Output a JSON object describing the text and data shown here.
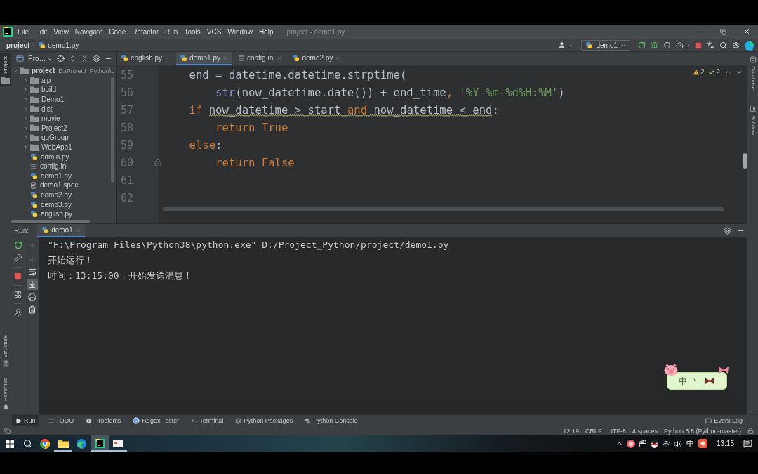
{
  "title_bar": {
    "menu": [
      "File",
      "Edit",
      "View",
      "Navigate",
      "Code",
      "Refactor",
      "Run",
      "Tools",
      "VCS",
      "Window",
      "Help"
    ],
    "title": "project - demo1.py"
  },
  "nav_bar": {
    "breadcrumbs": [
      {
        "label": "project",
        "kind": "folder"
      },
      {
        "label": "demo1.py",
        "kind": "python"
      }
    ],
    "run_config": "demo1"
  },
  "left_strip": [
    {
      "label": "Project",
      "kind": "project",
      "selected": true
    },
    {
      "label": "Structure",
      "kind": "structure",
      "selected": false
    },
    {
      "label": "Favorites",
      "kind": "favorites",
      "selected": false
    }
  ],
  "project_panel": {
    "title": "Pro…",
    "tree": [
      {
        "name": "project",
        "path": "D:\\Project_Python\\p",
        "kind": "folder",
        "expanded": true,
        "children": [
          {
            "name": "aip",
            "kind": "folder",
            "expanded": false
          },
          {
            "name": "build",
            "kind": "folder",
            "expanded": false
          },
          {
            "name": "Demo1",
            "kind": "folder",
            "expanded": false
          },
          {
            "name": "dist",
            "kind": "folder",
            "expanded": false
          },
          {
            "name": "movie",
            "kind": "folder",
            "expanded": false
          },
          {
            "name": "Project2",
            "kind": "folder",
            "expanded": false
          },
          {
            "name": "qqGroup",
            "kind": "folder",
            "expanded": false
          },
          {
            "name": "WebApp1",
            "kind": "folder",
            "expanded": false
          },
          {
            "name": "admin.py",
            "kind": "python"
          },
          {
            "name": "config.ini",
            "kind": "config"
          },
          {
            "name": "demo1.py",
            "kind": "python"
          },
          {
            "name": "demo1.spec",
            "kind": "spec"
          },
          {
            "name": "demo2.py",
            "kind": "python"
          },
          {
            "name": "demo3.py",
            "kind": "python"
          },
          {
            "name": "english.py",
            "kind": "python"
          }
        ]
      }
    ]
  },
  "editor": {
    "tabs": [
      {
        "label": "english.py",
        "kind": "python",
        "selected": false
      },
      {
        "label": "demo1.py",
        "kind": "python",
        "selected": true
      },
      {
        "label": "config.ini",
        "kind": "config",
        "selected": false
      },
      {
        "label": "demo2.py",
        "kind": "python",
        "selected": false
      }
    ],
    "inspections": [
      {
        "kind": "warning",
        "count": "2"
      },
      {
        "kind": "weak",
        "count": "2"
      }
    ],
    "lines": [
      {
        "number": "55",
        "fold": false,
        "tokens": [
          {
            "text": "    end = datetime.datetime.strptime(",
            "kind": "plain",
            "squiggle": false
          }
        ]
      },
      {
        "number": "56",
        "fold": false,
        "tokens": [
          {
            "text": "        str",
            "kind": "builtin",
            "squiggle": false
          },
          {
            "text": "(now_datetime.date()) + end_time",
            "kind": "plain",
            "squiggle": false
          },
          {
            "text": ", ",
            "kind": "punctuation",
            "squiggle": false
          },
          {
            "text": "'%Y-%m-%d%H:%M'",
            "kind": "string",
            "squiggle": false
          },
          {
            "text": ")",
            "kind": "plain",
            "squiggle": false
          }
        ]
      },
      {
        "number": "57",
        "fold": false,
        "tokens": [
          {
            "text": "    if ",
            "kind": "keyword",
            "squiggle": false
          },
          {
            "text": "now_datetime > start ",
            "kind": "plain",
            "squiggle": true
          },
          {
            "text": "and",
            "kind": "keyword",
            "squiggle": true
          },
          {
            "text": " now_datetime < end",
            "kind": "plain",
            "squiggle": true
          },
          {
            "text": ":",
            "kind": "plain",
            "squiggle": false
          }
        ]
      },
      {
        "number": "58",
        "fold": false,
        "tokens": [
          {
            "text": "        return True",
            "kind": "keyword",
            "squiggle": false
          }
        ]
      },
      {
        "number": "59",
        "fold": false,
        "tokens": [
          {
            "text": "    else",
            "kind": "keyword",
            "squiggle": false
          },
          {
            "text": ":",
            "kind": "plain",
            "squiggle": false
          }
        ]
      },
      {
        "number": "60",
        "fold": true,
        "tokens": [
          {
            "text": "        return False",
            "kind": "keyword",
            "squiggle": false
          }
        ]
      },
      {
        "number": "61",
        "fold": false
      },
      {
        "number": "62",
        "fold": false
      }
    ]
  },
  "right_strip": [
    {
      "label": "Database",
      "kind": "database"
    },
    {
      "label": "SciView",
      "kind": "sciview"
    }
  ],
  "run_window": {
    "label": "Run:",
    "tabs": [
      {
        "label": "demo1",
        "selected": true
      }
    ],
    "console_tools": [
      {
        "kind": "up",
        "disabled": true,
        "on": false
      },
      {
        "kind": "down",
        "disabled": true,
        "on": false
      },
      {
        "kind": "wrap",
        "disabled": false,
        "on": false
      },
      {
        "kind": "scroll",
        "disabled": false,
        "on": true
      },
      {
        "kind": "print",
        "disabled": false,
        "on": false
      },
      {
        "kind": "trash",
        "disabled": false,
        "on": false
      }
    ],
    "console": [
      "\"F:\\Program Files\\Python38\\python.exe\" D:/Project_Python/project/demo1.py",
      "开始运行！",
      "时间：13:15:00，开始发送消息！"
    ]
  },
  "ime_widget": {
    "mode": "中",
    "punctuation": "°,"
  },
  "tool_tabs": [
    {
      "label": "Run",
      "kind": "run",
      "selected": true
    },
    {
      "label": "TODO",
      "kind": "todo",
      "selected": false
    },
    {
      "label": "Problems",
      "kind": "problems",
      "selected": false
    },
    {
      "label": "Regex Tester",
      "kind": "regex",
      "selected": false
    },
    {
      "label": "Terminal",
      "kind": "terminal",
      "selected": false
    },
    {
      "label": "Python Packages",
      "kind": "packages",
      "selected": false
    },
    {
      "label": "Python Console",
      "kind": "console",
      "selected": false
    }
  ],
  "event_log": "Event Log",
  "status_bar": [
    "12:19",
    "CRLF",
    "UTF-8",
    "4 spaces",
    "Python 3.8 (Python-master)"
  ],
  "taskbar": {
    "apps": [
      {
        "kind": "ball",
        "running": false,
        "selected": false
      },
      {
        "kind": "folder",
        "running": true,
        "selected": false
      },
      {
        "kind": "wave",
        "running": false,
        "selected": false
      },
      {
        "kind": "ide",
        "running": true,
        "selected": true
      },
      {
        "kind": "window",
        "running": true,
        "selected": false
      }
    ],
    "input_mode": "中",
    "clock": "13:15"
  }
}
